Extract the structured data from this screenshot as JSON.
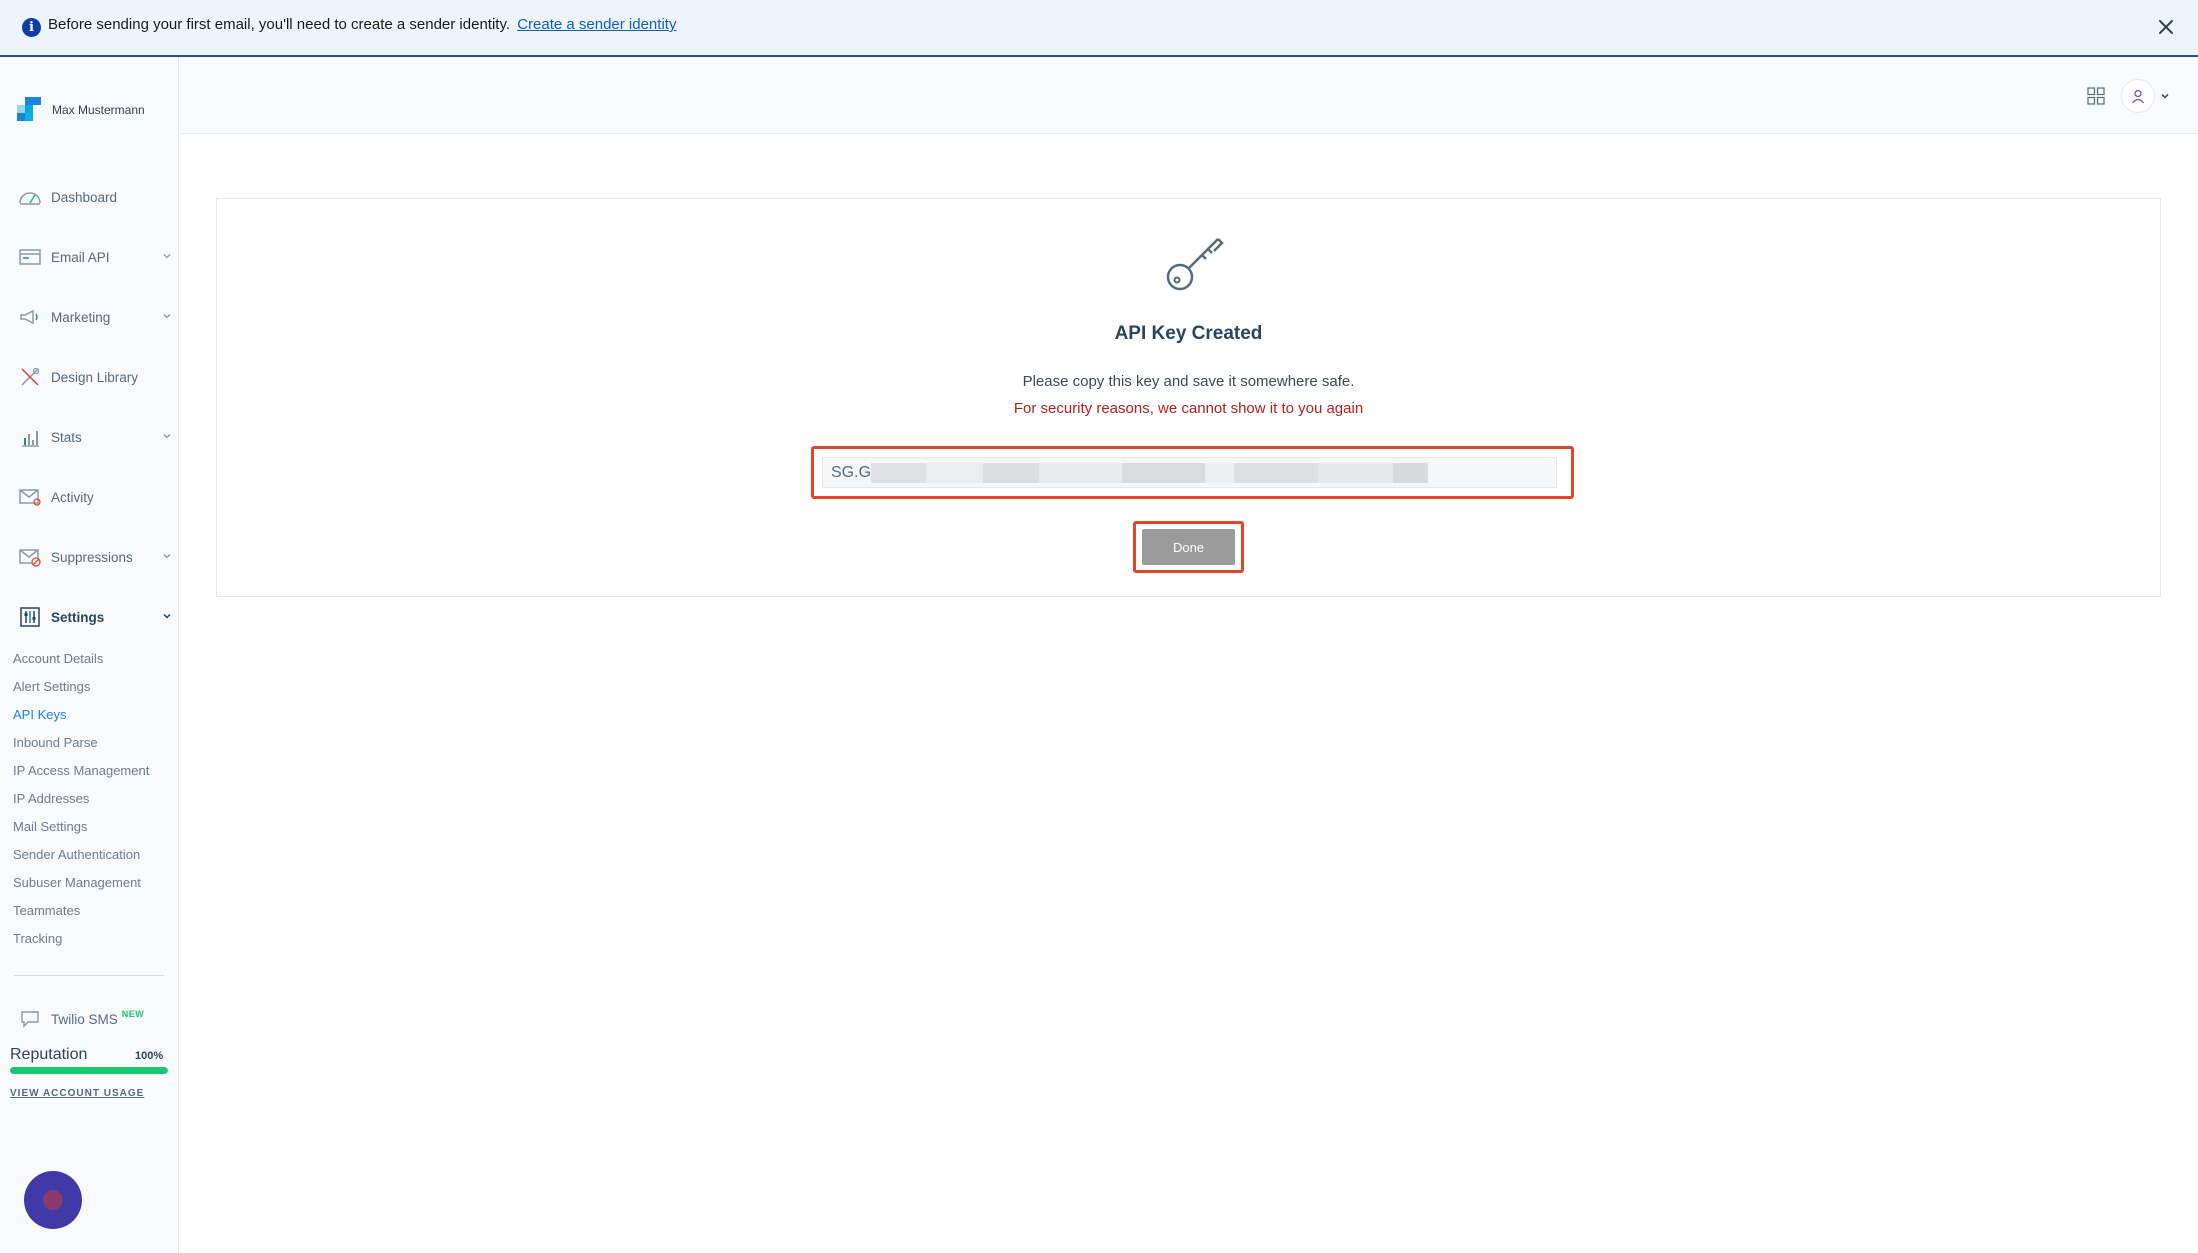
{
  "banner": {
    "message": "Before sending your first email, you'll need to create a sender identity.",
    "link": "Create a sender identity",
    "info_icon": "info-icon",
    "close_icon": "close-icon"
  },
  "sidebar": {
    "account_name": "Max Mustermann",
    "items": [
      {
        "label": "Dashboard",
        "icon": "dashboard-icon"
      },
      {
        "label": "Email API",
        "icon": "email-api-icon"
      },
      {
        "label": "Marketing",
        "icon": "megaphone-icon"
      },
      {
        "label": "Design Library",
        "icon": "design-library-icon"
      },
      {
        "label": "Stats",
        "icon": "stats-icon"
      },
      {
        "label": "Activity",
        "icon": "activity-icon"
      },
      {
        "label": "Suppressions",
        "icon": "suppressions-icon"
      },
      {
        "label": "Settings",
        "icon": "settings-icon"
      }
    ],
    "settings_items": [
      "Account Details",
      "Alert Settings",
      "API Keys",
      "Inbound Parse",
      "IP Access Management",
      "IP Addresses",
      "Mail Settings",
      "Sender Authentication",
      "Subuser Management",
      "Teammates",
      "Tracking"
    ],
    "active_settings_item": "API Keys",
    "twilio": {
      "label": "Twilio SMS",
      "badge": "NEW"
    },
    "reputation": {
      "label": "Reputation",
      "value": "100%",
      "fraction": 1.0
    },
    "view_usage": "VIEW ACCOUNT USAGE"
  },
  "colors": {
    "accent": "#1a82e2",
    "highlight_outline": "#e2462b",
    "warning_text": "#b61f1f",
    "reputation_bar": "#18c96e",
    "done_button": "#9b9b9b"
  },
  "main": {
    "title": "API Key Created",
    "message": "Please copy this key and save it somewhere safe.",
    "warning": "For security reasons, we cannot show it to you again",
    "key_prefix": "SG.G",
    "done_label": "Done"
  }
}
